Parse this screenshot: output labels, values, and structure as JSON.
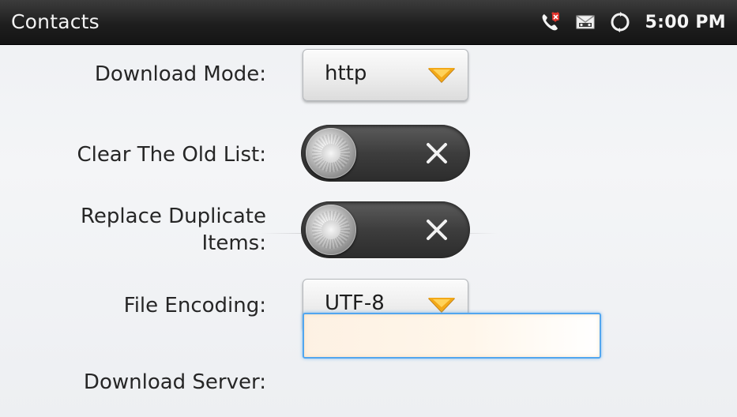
{
  "status_bar": {
    "title": "Contacts",
    "time": "5:00 PM",
    "icons": [
      "missed-call-icon",
      "voicemail-icon",
      "sync-icon"
    ]
  },
  "form": {
    "download_mode": {
      "label": "Download Mode:",
      "value": "http"
    },
    "clear_old_list": {
      "label": "Clear The Old List:",
      "state": "off"
    },
    "replace_duplicates": {
      "label_line1": "Replace Duplicate",
      "label_line2": "Items:",
      "state": "off"
    },
    "file_encoding": {
      "label": "File Encoding:",
      "value": "UTF-8"
    },
    "download_server": {
      "label": "Download Server:",
      "value": ""
    }
  },
  "colors": {
    "accent_arrow": "#f2a818",
    "focus_border": "#52a6ef",
    "status_bar_bg": "#1e1e1e",
    "missed_call_red": "#e0342c"
  }
}
